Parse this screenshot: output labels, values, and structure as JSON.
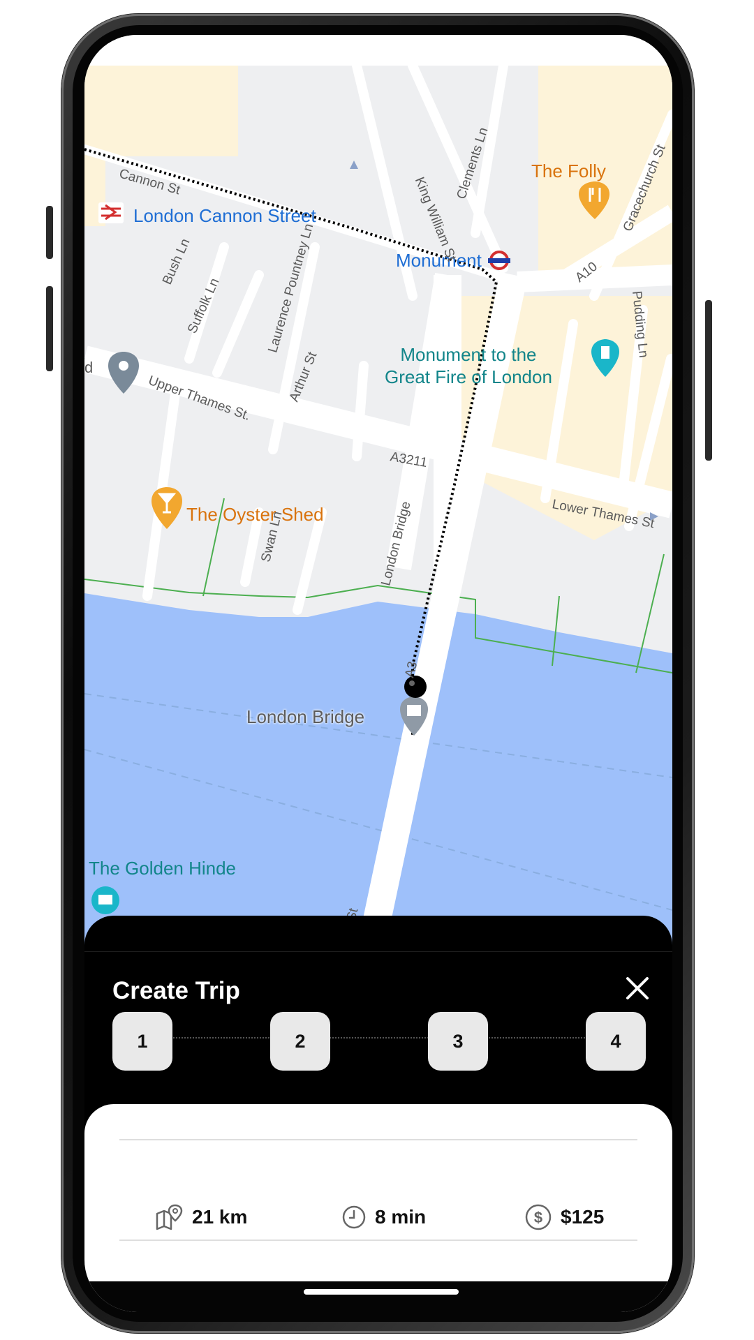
{
  "map": {
    "labels": {
      "london_cannon_street": "London Cannon Street",
      "monument": "Monument",
      "the_folly": "The Folly",
      "monument_fire_line1": "Monument to the",
      "monument_fire_line2": "Great Fire of London",
      "the_oyster_shed": "The Oyster Shed",
      "london_bridge": "London Bridge",
      "the_golden_hinde": "The Golden Hinde",
      "cut_label": "d"
    },
    "streets": {
      "cannon_st": "Cannon St",
      "king_william_st": "King William St",
      "clements_ln": "Clements Ln",
      "gracechurch_st": "Gracechurch St",
      "a10": "A10",
      "bush_ln": "Bush Ln",
      "suffolk_ln": "Suffolk Ln",
      "laurence_pountney_ln": "Laurence Pountney Ln",
      "arthur_st": "Arthur St",
      "pudding_ln": "Pudding Ln",
      "upper_thames_st": "Upper Thames St.",
      "a3211": "A3211",
      "lower_thames_st": "Lower Thames St",
      "swan_ln": "Swan Ln",
      "london_bridge_road": "London Bridge",
      "a3": "A3",
      "high_st": "gh St"
    },
    "colors": {
      "water": "#9ec0fa",
      "land": "#eeeff1",
      "road": "#ffffff",
      "commercial": "#fdf3d9",
      "park_line": "#4caf50",
      "route": "#000000"
    }
  },
  "sheet": {
    "title": "Create Trip",
    "close_icon": "close-icon",
    "steps": [
      "1",
      "2",
      "3",
      "4"
    ],
    "stats": {
      "distance": "21 km",
      "duration": "8 min",
      "price": "$125"
    },
    "stat_icons": [
      "map-pin-icon",
      "clock-icon",
      "dollar-icon"
    ]
  }
}
